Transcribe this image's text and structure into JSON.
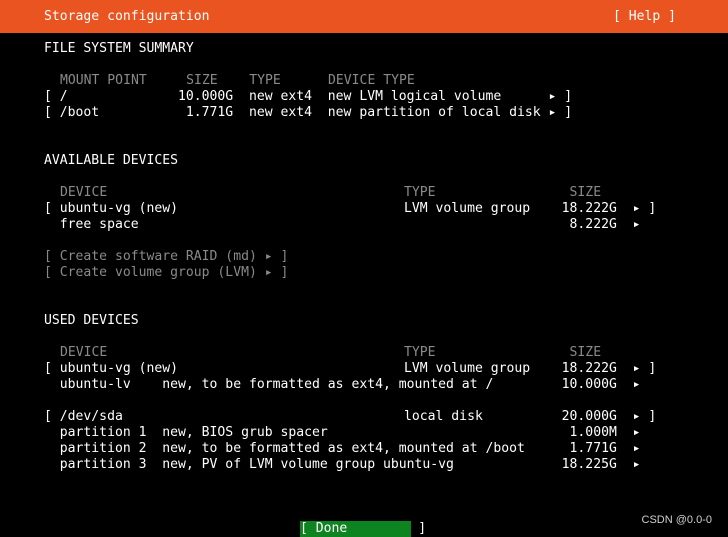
{
  "header": {
    "title": "Storage configuration",
    "help": "[ Help ]"
  },
  "fs_summary": {
    "heading": "FILE SYSTEM SUMMARY",
    "header_row": "MOUNT POINT     SIZE    TYPE      DEVICE TYPE",
    "rows": [
      "[ /              10.000G  new ext4  new LVM logical volume      ▸ ]",
      "[ /boot           1.771G  new ext4  new partition of local disk ▸ ]"
    ]
  },
  "available": {
    "heading": "AVAILABLE DEVICES",
    "header_left": "DEVICE",
    "header_right": "TYPE                 SIZE",
    "rows": [
      {
        "left": "[ ubuntu-vg (new)",
        "right": "LVM volume group    18.222G  ▸ ]"
      },
      {
        "left": "  free space",
        "right": "                     8.222G  ▸"
      }
    ],
    "actions": [
      "[ Create software RAID (md) ▸ ]",
      "[ Create volume group (LVM) ▸ ]"
    ]
  },
  "used": {
    "heading": "USED DEVICES",
    "header_left": "DEVICE",
    "header_right": "TYPE                 SIZE",
    "rows": [
      {
        "left": "[ ubuntu-vg (new)",
        "right": "LVM volume group    18.222G  ▸ ]"
      },
      {
        "left": "  ubuntu-lv    new, to be formatted as ext4, mounted at /",
        "right": "                    10.000G  ▸"
      },
      {
        "left": "[ /dev/sda",
        "right": "local disk          20.000G  ▸ ]"
      },
      {
        "left": "  partition 1  new, BIOS grub spacer",
        "right": "                     1.000M  ▸"
      },
      {
        "left": "  partition 2  new, to be formatted as ext4, mounted at /boot",
        "right": "                     1.771G  ▸"
      },
      {
        "left": "  partition 3  new, PV of LVM volume group ubuntu-vg",
        "right": "                    18.225G  ▸"
      }
    ]
  },
  "footer": {
    "done": "[ Done         ]",
    "watermark": "CSDN @0.0-0"
  },
  "colors": {
    "header": "#e95420",
    "done": "#0e8420",
    "dim": "#8a8a8a"
  }
}
